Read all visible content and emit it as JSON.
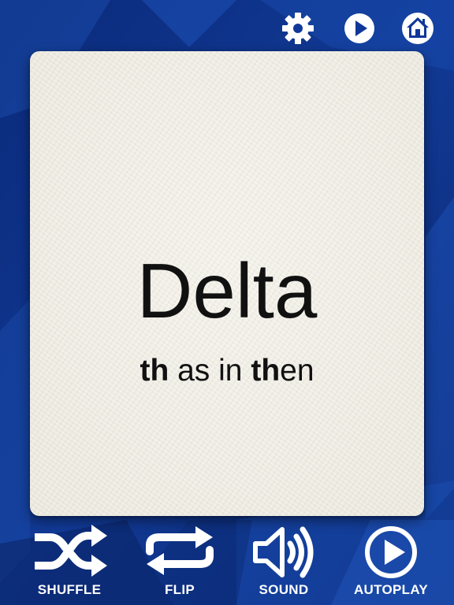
{
  "colors": {
    "background_dark": "#0b2a7a",
    "background_light": "#1c4fb0",
    "card": "#efece3",
    "text": "#111111",
    "icon": "#ffffff"
  },
  "top_bar": {
    "settings_icon": "gear-icon",
    "play_icon": "play-circle-icon",
    "home_icon": "home-icon"
  },
  "card": {
    "word": "Delta",
    "hint_bold_1": "th",
    "hint_plain_1": " as in ",
    "hint_bold_2": "th",
    "hint_plain_2": "en"
  },
  "bottom_bar": {
    "shuffle_label": "SHUFFLE",
    "flip_label": "FLIP",
    "sound_label": "SOUND",
    "autoplay_label": "AUTOPLAY",
    "shuffle_icon": "shuffle-icon",
    "flip_icon": "repeat-icon",
    "sound_icon": "speaker-icon",
    "autoplay_icon": "play-circle-icon"
  }
}
